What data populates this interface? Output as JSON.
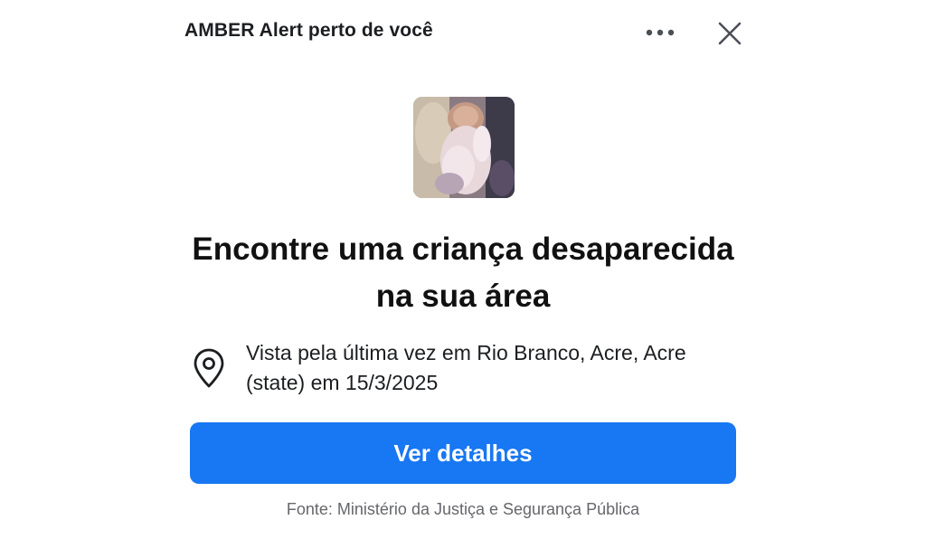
{
  "header": {
    "title": "AMBER Alert perto de você"
  },
  "icons": {
    "more": "more-options-icon",
    "close": "close-icon",
    "location": "location-pin-icon"
  },
  "alert": {
    "photo_alt": "Foto da criança desaparecida",
    "headline": "Encontre uma criança desaparecida na sua área",
    "location_text": "Vista pela última vez em Rio Branco, Acre, Acre (state) em 15/3/2025"
  },
  "actions": {
    "details_label": "Ver detalhes"
  },
  "footer": {
    "source": "Fonte: Ministério da Justiça e Segurança Pública"
  },
  "colors": {
    "accent": "#1877f2",
    "text": "#1c1e21",
    "muted": "#65676b"
  }
}
